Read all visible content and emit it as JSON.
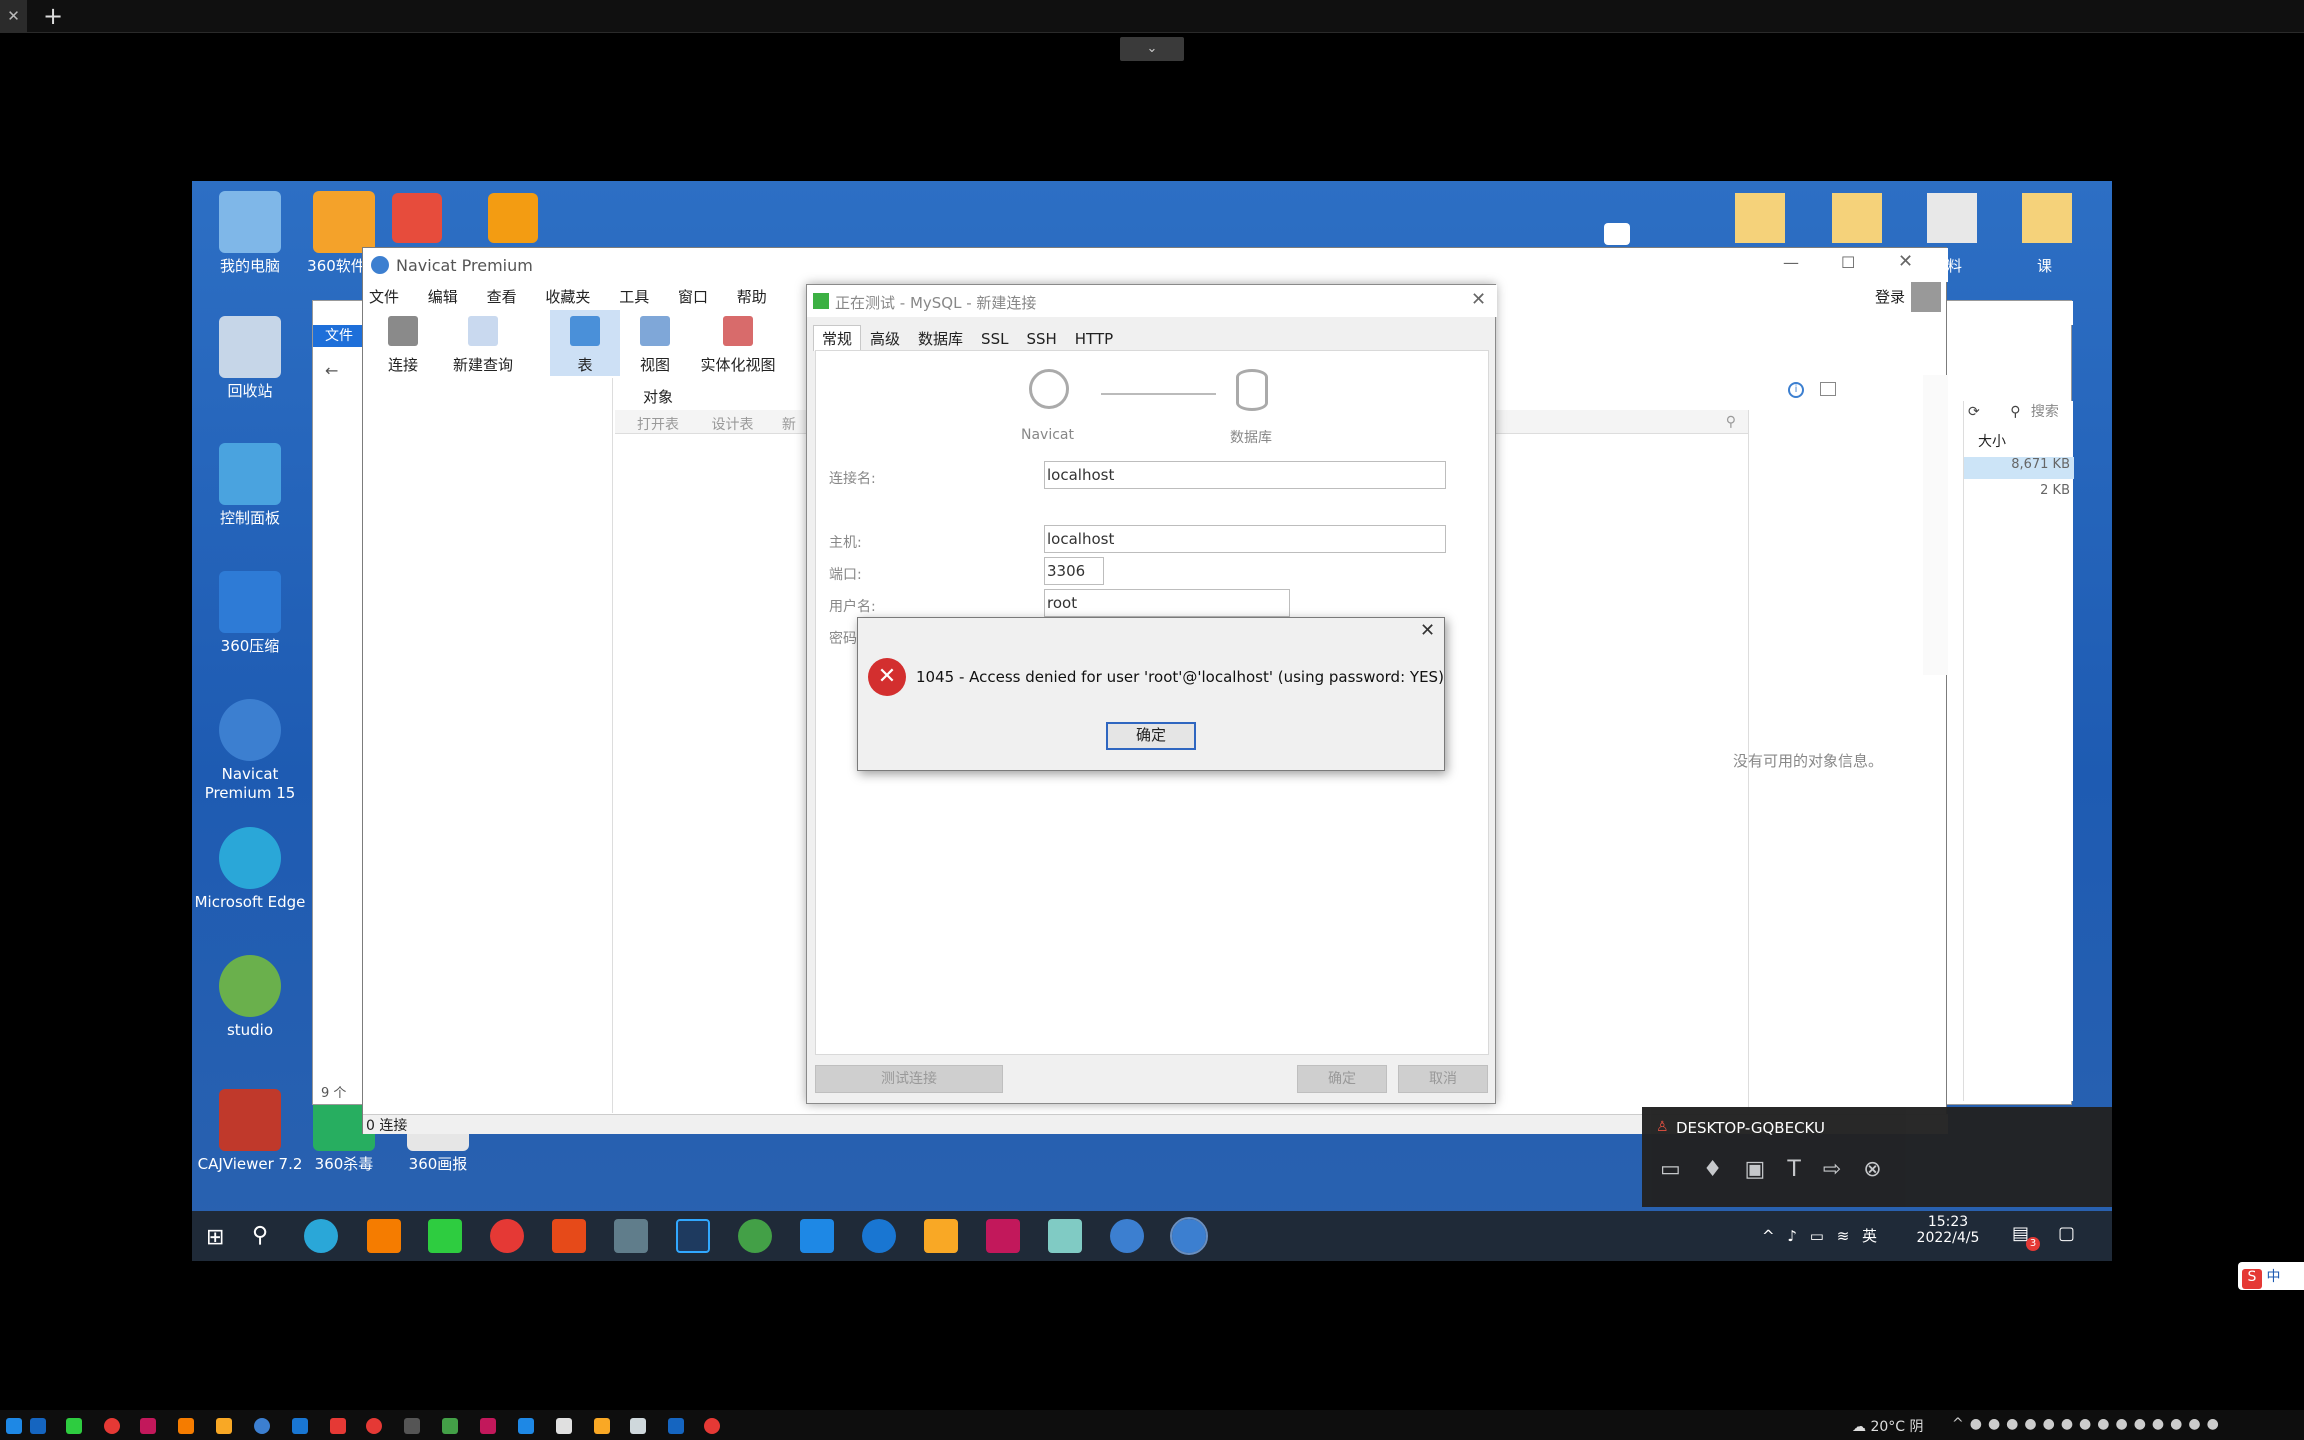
{
  "desktop_icons": [
    {
      "label": "我的电脑",
      "color": "#7fb7e8"
    },
    {
      "label": "360软件管",
      "color": "#f4a22a"
    },
    {
      "label": "回收站",
      "color": "#c6d6e8"
    },
    {
      "label": "控制面板",
      "color": "#4aa3df"
    },
    {
      "label": "360压缩",
      "color": "#2e7bd6"
    },
    {
      "label": "Navicat Premium 15",
      "color": "#3c7fd0"
    },
    {
      "label": "Microsoft Edge",
      "color": "#2aa7d8"
    },
    {
      "label": "studio",
      "color": "#6ab04c"
    },
    {
      "label": "CAJViewer 7.2",
      "color": "#c0392b"
    },
    {
      "label": "360杀毒",
      "color": "#27ae60"
    },
    {
      "label": "360画报",
      "color": "#e6e6e6"
    }
  ],
  "right_icons": [
    "料",
    "课"
  ],
  "navicat": {
    "title": "Navicat Premium",
    "login": "登录",
    "menu": [
      "文件",
      "编辑",
      "查看",
      "收藏夹",
      "工具",
      "窗口",
      "帮助"
    ],
    "toolbar": [
      "连接",
      "新建查询",
      "表",
      "视图",
      "实体化视图"
    ],
    "objects_tab": "对象",
    "obj_toolbar": [
      "打开表",
      "设计表",
      "新"
    ],
    "status": "0 连接",
    "no_info": "没有可用的对象信息。"
  },
  "explorer": {
    "file_tab": "文件",
    "size_header": "大小",
    "sizes": [
      "8,671 KB",
      "2 KB"
    ],
    "search": "搜索",
    "count": "9 个"
  },
  "conn_window": {
    "title": "正在测试 - MySQL - 新建连接",
    "tabs": [
      "常规",
      "高级",
      "数据库",
      "SSL",
      "SSH",
      "HTTP"
    ],
    "navicat_label": "Navicat",
    "db_label": "数据库",
    "fields": {
      "conn_name_label": "连接名:",
      "conn_name": "localhost",
      "host_label": "主机:",
      "host": "localhost",
      "port_label": "端口:",
      "port": "3306",
      "user_label": "用户名:",
      "user": "root",
      "pwd_label": "密码:"
    },
    "test_btn": "测试连接",
    "ok_btn": "确定",
    "cancel_btn": "取消"
  },
  "error": {
    "message": "1045 - Access denied for user 'root'@'localhost' (using password: YES)",
    "ok": "确定"
  },
  "remote": {
    "host": "DESKTOP-GQBECKU"
  },
  "taskbar": {
    "time": "15:23",
    "date": "2022/4/5",
    "ime": "英",
    "badge": "3"
  },
  "host_taskbar": {
    "weather": "20°C 阴",
    "ime": "中"
  }
}
